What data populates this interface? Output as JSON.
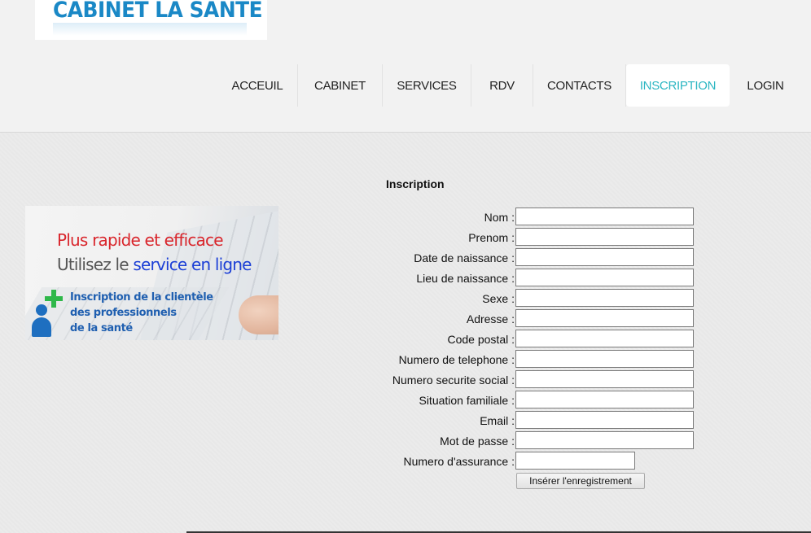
{
  "logo": {
    "text": "CABINET LA SANTE"
  },
  "nav": {
    "items": [
      {
        "label": "ACCEUIL",
        "active": false
      },
      {
        "label": "CABINET",
        "active": false
      },
      {
        "label": "SERVICES",
        "active": false
      },
      {
        "label": "RDV",
        "active": false
      },
      {
        "label": "CONTACTS",
        "active": false
      },
      {
        "label": "INSCRIPTION",
        "active": true
      },
      {
        "label": "LOGIN",
        "active": false
      }
    ],
    "active_color": "#2bb6c2"
  },
  "banner": {
    "line1": "Plus rapide et efficace",
    "line2_prefix": "Utilisez le ",
    "line2_highlight": "service en ligne",
    "caption_line1": "Inscription de la clientèle",
    "caption_line2": "des professionnels",
    "caption_line3": "de la santé"
  },
  "form": {
    "title": "Inscription",
    "fields": [
      {
        "label": "Nom :",
        "value": ""
      },
      {
        "label": "Prenom :",
        "value": ""
      },
      {
        "label": "Date de naissance :",
        "value": ""
      },
      {
        "label": "Lieu de naissance :",
        "value": ""
      },
      {
        "label": "Sexe :",
        "value": ""
      },
      {
        "label": "Adresse :",
        "value": ""
      },
      {
        "label": "Code postal :",
        "value": ""
      },
      {
        "label": "Numero de telephone :",
        "value": ""
      },
      {
        "label": "Numero securite social :",
        "value": ""
      },
      {
        "label": "Situation familiale :",
        "value": ""
      },
      {
        "label": "Email :",
        "value": ""
      },
      {
        "label": "Mot de passe :",
        "value": ""
      },
      {
        "label": "Numero d'assurance :",
        "value": ""
      }
    ],
    "submit_label": "Insérer l'enregistrement"
  }
}
